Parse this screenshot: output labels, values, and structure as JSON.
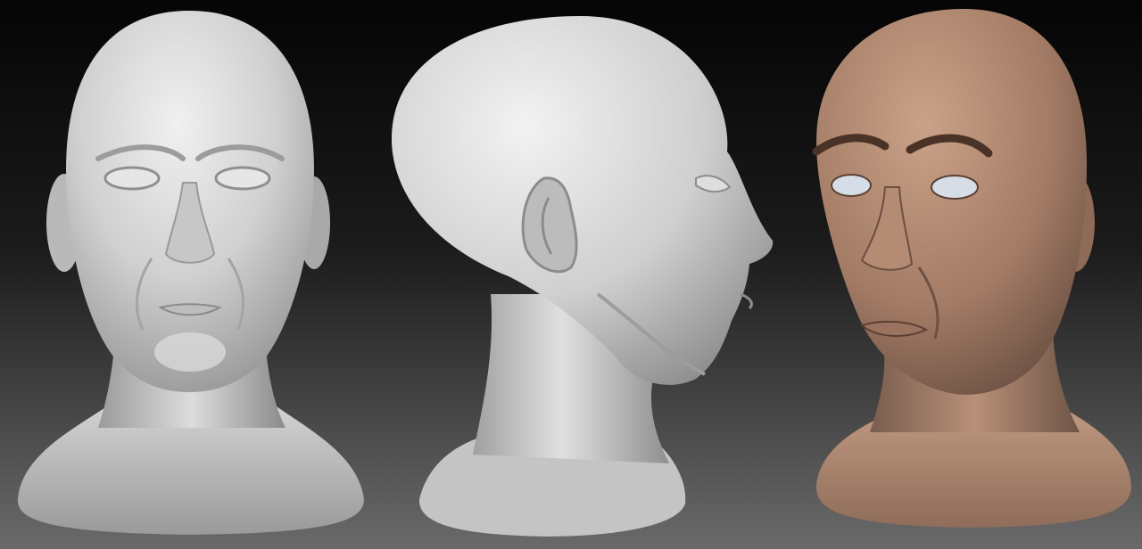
{
  "scene": {
    "background": {
      "top_color": "#050505",
      "mid_color": "#1a1a1a",
      "bottom_color": "#6a6a6a"
    },
    "views": [
      {
        "id": "front",
        "description_name": "front-view-head-sculpt",
        "material": "clay-grey",
        "base_color": "#cfcfcf"
      },
      {
        "id": "side",
        "description_name": "side-view-head-sculpt",
        "material": "clay-grey",
        "base_color": "#cdcdcd"
      },
      {
        "id": "angled",
        "description_name": "three-quarter-view-head-sculpt",
        "material": "skin-toned",
        "base_color": "#b08a74"
      }
    ]
  }
}
